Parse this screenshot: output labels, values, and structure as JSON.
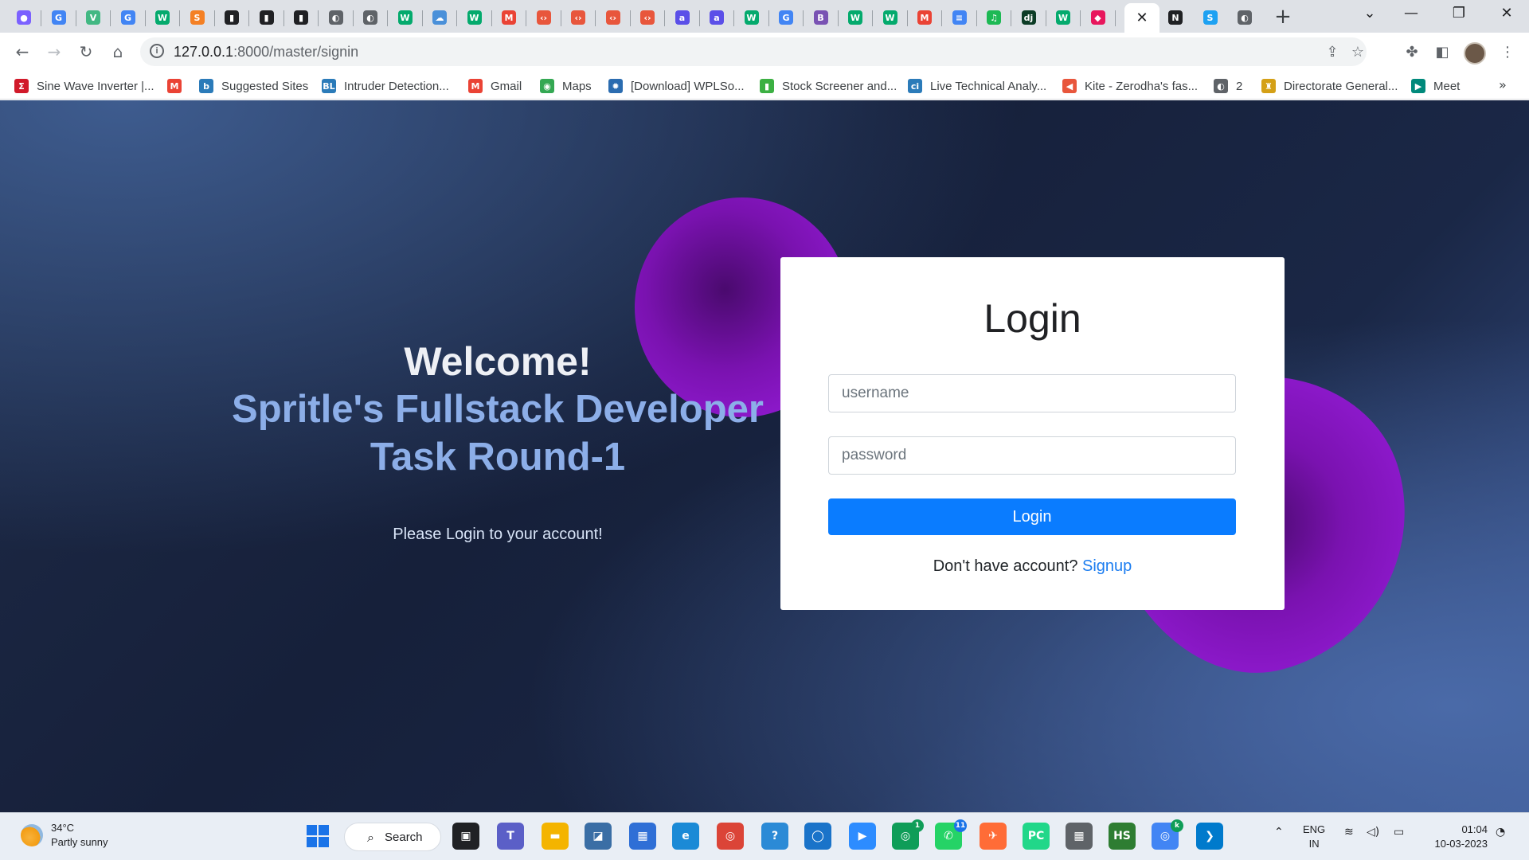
{
  "browser": {
    "tab_favicons": [
      {
        "icon": "copilot-icon",
        "glyph": "●",
        "color": "#7b61ff"
      },
      {
        "icon": "google-icon",
        "glyph": "G",
        "color": "#4285f4"
      },
      {
        "icon": "vue-icon",
        "glyph": "V",
        "color": "#42b883"
      },
      {
        "icon": "google-icon",
        "glyph": "G",
        "color": "#4285f4"
      },
      {
        "icon": "w3schools-icon",
        "glyph": "W",
        "color": "#04aa6d"
      },
      {
        "icon": "stackoverflow-icon",
        "glyph": "S",
        "color": "#f48024"
      },
      {
        "icon": "terminal-icon",
        "glyph": "▮",
        "color": "#202124"
      },
      {
        "icon": "terminal-icon",
        "glyph": "▮",
        "color": "#202124"
      },
      {
        "icon": "terminal-icon",
        "glyph": "▮",
        "color": "#202124"
      },
      {
        "icon": "globe-icon",
        "glyph": "◐",
        "color": "#5f6368"
      },
      {
        "icon": "globe-icon",
        "glyph": "◐",
        "color": "#5f6368"
      },
      {
        "icon": "w3schools-icon",
        "glyph": "W",
        "color": "#04aa6d"
      },
      {
        "icon": "cloud-icon",
        "glyph": "☁",
        "color": "#4a90d9"
      },
      {
        "icon": "w3schools-icon",
        "glyph": "W",
        "color": "#04aa6d"
      },
      {
        "icon": "gmail-icon",
        "glyph": "M",
        "color": "#ea4335"
      },
      {
        "icon": "code-icon",
        "glyph": "‹›",
        "color": "#e8563c"
      },
      {
        "icon": "code-icon",
        "glyph": "‹›",
        "color": "#e8563c"
      },
      {
        "icon": "code-icon",
        "glyph": "‹›",
        "color": "#e8563c"
      },
      {
        "icon": "code-icon",
        "glyph": "‹›",
        "color": "#e8563c"
      },
      {
        "icon": "a-icon",
        "glyph": "a",
        "color": "#5b4fe8"
      },
      {
        "icon": "a-icon",
        "glyph": "a",
        "color": "#5b4fe8"
      },
      {
        "icon": "w3schools-icon",
        "glyph": "W",
        "color": "#04aa6d"
      },
      {
        "icon": "google-icon",
        "glyph": "G",
        "color": "#4285f4"
      },
      {
        "icon": "bootstrap-icon",
        "glyph": "B",
        "color": "#7952b3"
      },
      {
        "icon": "w3schools-icon",
        "glyph": "W",
        "color": "#04aa6d"
      },
      {
        "icon": "w3schools-icon",
        "glyph": "W",
        "color": "#04aa6d"
      },
      {
        "icon": "gmail-icon",
        "glyph": "M",
        "color": "#ea4335"
      },
      {
        "icon": "docs-icon",
        "glyph": "≡",
        "color": "#4285f4"
      },
      {
        "icon": "spotify-icon",
        "glyph": "♫",
        "color": "#1db954"
      },
      {
        "icon": "django-icon",
        "glyph": "dj",
        "color": "#0c3c26"
      },
      {
        "icon": "w3schools-icon",
        "glyph": "W",
        "color": "#04aa6d"
      },
      {
        "icon": "cube-icon",
        "glyph": "◆",
        "color": "#e8175d"
      }
    ],
    "after_active_favicons": [
      {
        "icon": "notion-icon",
        "glyph": "N",
        "color": "#202124"
      },
      {
        "icon": "s-icon",
        "glyph": "S",
        "color": "#1da1f2"
      },
      {
        "icon": "globe-icon",
        "glyph": "◐",
        "color": "#5f6368"
      }
    ],
    "active_tab_close": "✕",
    "new_tab": "+",
    "url_host": "127.0.0.1",
    "url_path": ":8000/master/signin",
    "bookmarks": [
      {
        "icon": "sigma-icon",
        "glyph": "Σ",
        "color": "#d11a2a",
        "label": "Sine Wave Inverter |..."
      },
      {
        "icon": "gmail-icon",
        "glyph": "M",
        "color": "#ea4335",
        "label": ""
      },
      {
        "icon": "bing-icon",
        "glyph": "b",
        "color": "#2b7bb9",
        "label": "Suggested Sites"
      },
      {
        "icon": "bl-icon",
        "glyph": "BL",
        "color": "#2b7bb9",
        "label": "Intruder Detection..."
      },
      {
        "icon": "gmail-icon",
        "glyph": "M",
        "color": "#ea4335",
        "label": "Gmail"
      },
      {
        "icon": "maps-icon",
        "glyph": "◉",
        "color": "#34a853",
        "label": "Maps"
      },
      {
        "icon": "gear-icon",
        "glyph": "✹",
        "color": "#2b6cb0",
        "label": "[Download] WPLSo..."
      },
      {
        "icon": "chart-icon",
        "glyph": "▮",
        "color": "#3cb043",
        "label": "Stock Screener and..."
      },
      {
        "icon": "ci-icon",
        "glyph": "ci",
        "color": "#2b7bb9",
        "label": "Live Technical Analy..."
      },
      {
        "icon": "kite-icon",
        "glyph": "◀",
        "color": "#e8563c",
        "label": "Kite - Zerodha's fas..."
      },
      {
        "icon": "globe-icon",
        "glyph": "◐",
        "color": "#5f6368",
        "label": "2"
      },
      {
        "icon": "emblem-icon",
        "glyph": "♜",
        "color": "#d4a017",
        "label": "Directorate General..."
      },
      {
        "icon": "meet-icon",
        "glyph": "▶",
        "color": "#00897b",
        "label": "Meet"
      }
    ],
    "bookmarks_more": "»"
  },
  "page": {
    "welcome": "Welcome!",
    "tagline_line1": "Spritle's Fullstack Developer",
    "tagline_line2": "Task Round-1",
    "subtitle": "Please Login to your account!",
    "login": {
      "title": "Login",
      "username_placeholder": "username",
      "password_placeholder": "password",
      "button": "Login",
      "signup_prompt": "Don't have account?",
      "signup_link": "Signup"
    }
  },
  "taskbar": {
    "weather_temp": "34°C",
    "weather_desc": "Partly sunny",
    "search_label": "Search",
    "lang_line1": "ENG",
    "lang_line2": "IN",
    "time": "01:04",
    "date": "10-03-2023",
    "app_icons": [
      {
        "icon": "task-view-icon",
        "glyph": "▣",
        "color": "#202124"
      },
      {
        "icon": "teams-icon",
        "glyph": "T",
        "color": "#5b5fc7"
      },
      {
        "icon": "file-explorer-icon",
        "glyph": "▬",
        "color": "#f4b400"
      },
      {
        "icon": "mysql-workbench-icon",
        "glyph": "◪",
        "color": "#3a6ea5"
      },
      {
        "icon": "microsoft-store-icon",
        "glyph": "▦",
        "color": "#2f6fd6"
      },
      {
        "icon": "edge-icon",
        "glyph": "e",
        "color": "#1b8ad6"
      },
      {
        "icon": "chrome-icon",
        "glyph": "◎",
        "color": "#db4437"
      },
      {
        "icon": "help-icon",
        "glyph": "?",
        "color": "#2b8ad6"
      },
      {
        "icon": "app-icon",
        "glyph": "◯",
        "color": "#1a73c9"
      },
      {
        "icon": "zoom-icon",
        "glyph": "▶",
        "color": "#2d8cff"
      },
      {
        "icon": "chrome-icon",
        "glyph": "◎",
        "color": "#0f9d58"
      },
      {
        "icon": "whatsapp-icon",
        "glyph": "✆",
        "color": "#25d366"
      },
      {
        "icon": "postman-icon",
        "glyph": "✈",
        "color": "#ff6c37"
      },
      {
        "icon": "pycharm-icon",
        "glyph": "PC",
        "color": "#21d789"
      },
      {
        "icon": "calculator-icon",
        "glyph": "▦",
        "color": "#5f6368"
      },
      {
        "icon": "hs-icon",
        "glyph": "HS",
        "color": "#2e7d32"
      },
      {
        "icon": "chrome-icon",
        "glyph": "◎",
        "color": "#4285f4"
      },
      {
        "icon": "vscode-icon",
        "glyph": "❯",
        "color": "#007acc"
      }
    ],
    "badges": {
      "chrome": "1",
      "whatsapp": "11",
      "chrome2": "k"
    }
  }
}
